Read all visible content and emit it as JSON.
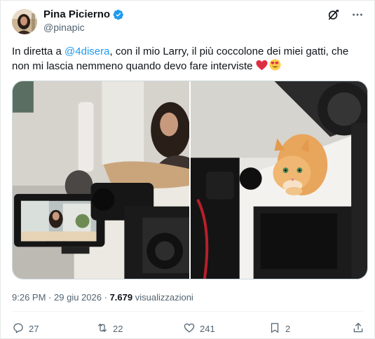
{
  "author": {
    "display_name": "Pina Picierno",
    "handle": "@pinapic",
    "verified": true
  },
  "icons": {
    "verified": "verified-badge-icon",
    "grok": "grok-icon",
    "more": "more-icon",
    "reply": "reply-icon",
    "retweet": "retweet-icon",
    "like": "heart-icon",
    "bookmark": "bookmark-icon",
    "share": "share-icon"
  },
  "tweet": {
    "text_before": "In diretta a ",
    "mention": "@4disera",
    "text_after": ", con il mio Larry, il più coccolone dei miei gatti, che non mi lascia nemmeno quando devo fare interviste ",
    "emojis": [
      "heart-emoji",
      "heart-eyes-emoji"
    ]
  },
  "media": {
    "photos": [
      "photo-interview-camera",
      "photo-orange-cat"
    ]
  },
  "meta": {
    "time": "9:26 PM",
    "separator": "·",
    "date": "29 giu 2026",
    "views_count": "7.679",
    "views_label": "visualizzazioni"
  },
  "actions": {
    "replies": "27",
    "reposts": "22",
    "likes": "241",
    "bookmarks": "2"
  },
  "colors": {
    "accent": "#1d9bf0",
    "text": "#0f1419",
    "secondary": "#536471",
    "border": "#cfd9de"
  }
}
